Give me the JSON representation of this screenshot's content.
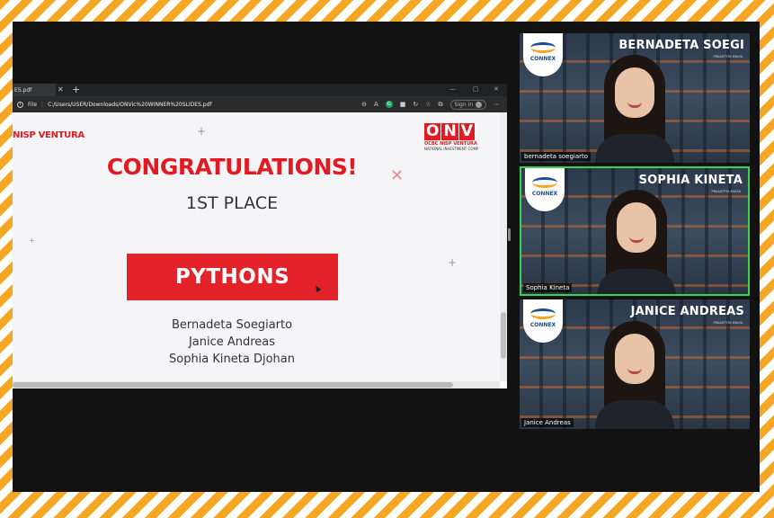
{
  "browser": {
    "tab_title": "ES.pdf",
    "file_label": "File",
    "url": "C:/Users/USER/Downloads/ONVic%20WINNER%20SLIDES.pdf",
    "signin_label": "Sign in"
  },
  "slide": {
    "left_logo": "NISP VENTURA",
    "onv_logo": {
      "letters": [
        "O",
        "N",
        "V"
      ],
      "line1": "OCBC NISP VENTURA",
      "line2": "NATIONAL INVESTMENT COMP"
    },
    "heading": "CONGRATULATIONS!",
    "place": "1ST PLACE",
    "team": "PYTHONS",
    "members": [
      "Bernadeta Soegiarto",
      "Janice Andreas",
      "Sophia Kineta Djohan"
    ]
  },
  "participants": [
    {
      "banner": "BERNADETA SOEGI",
      "name_tag": "bernadeta soegiarto",
      "active": false
    },
    {
      "banner": "SOPHIA KINETA",
      "name_tag": "Sophia Kineta",
      "active": true
    },
    {
      "banner": "JANICE ANDREAS",
      "name_tag": "Janice Andreas",
      "active": false
    }
  ],
  "tile_logo": {
    "text": "CONNEX",
    "mini": "PRAASTYTA MULYA"
  },
  "colors": {
    "brand_red": "#e21b23",
    "frame_stripe": "#f5a623",
    "active_speaker": "#39d353"
  }
}
